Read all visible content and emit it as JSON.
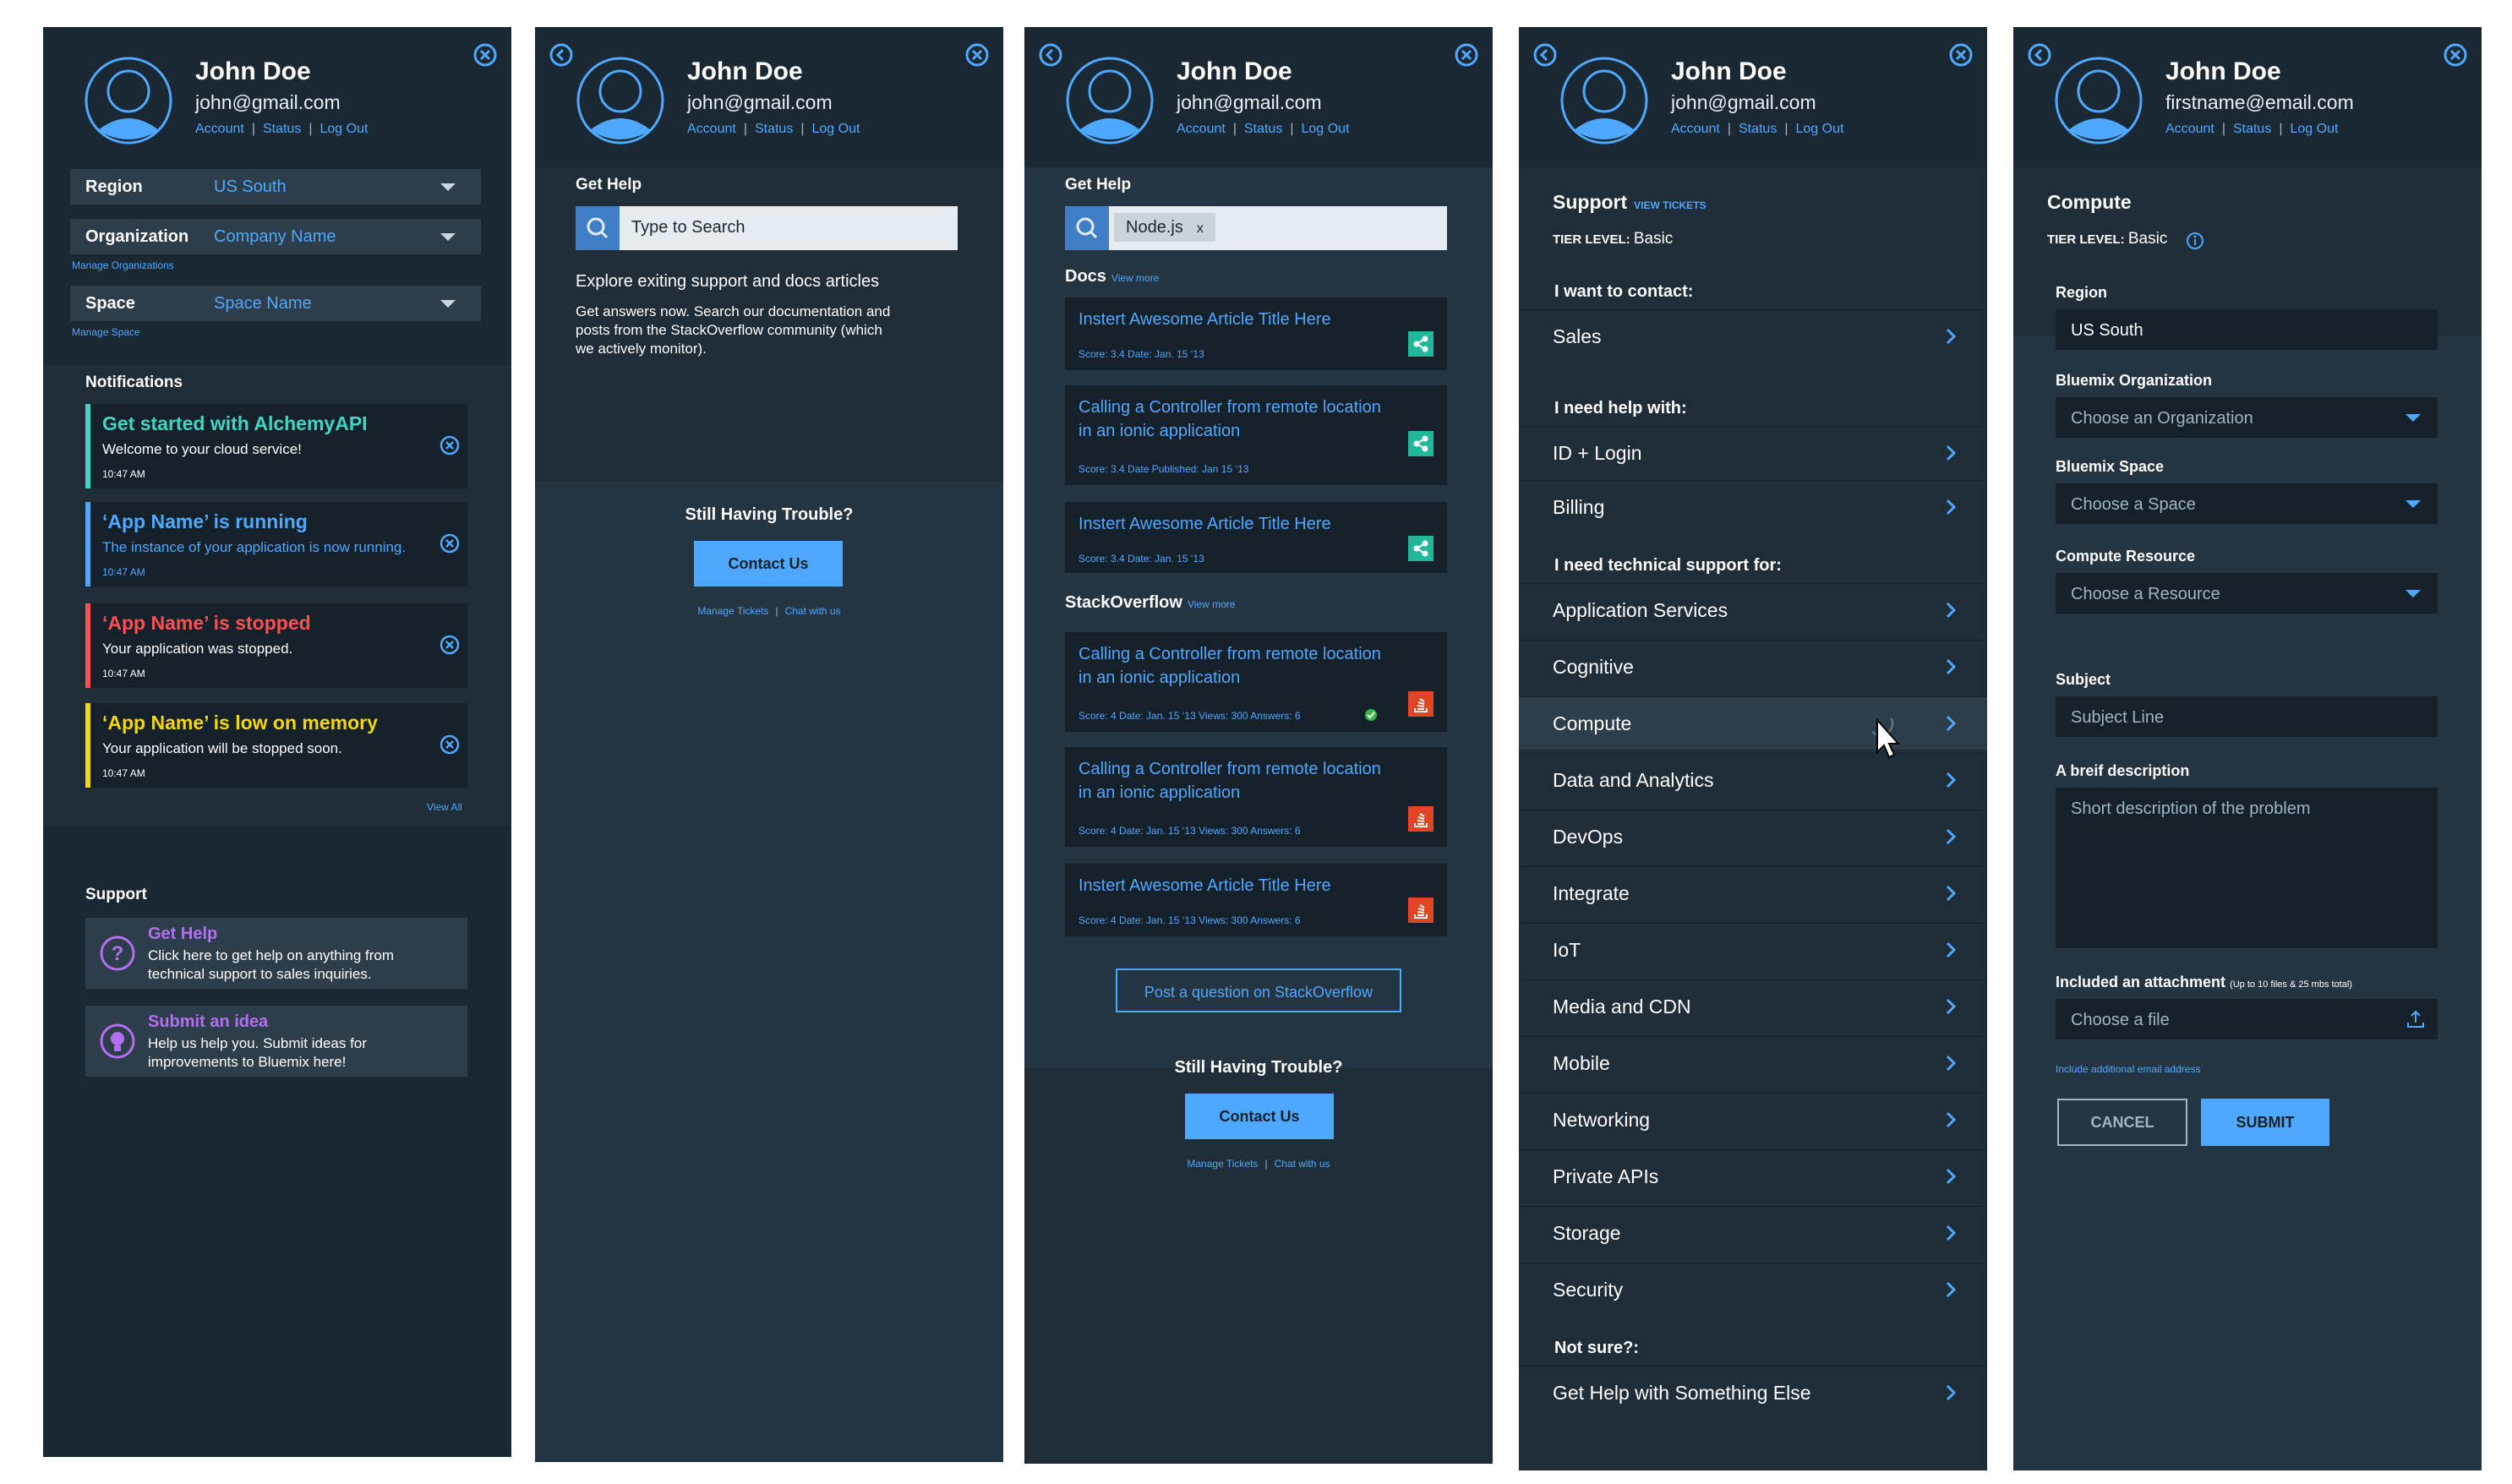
{
  "user": {
    "name": "John Doe",
    "email": "john@gmail.com",
    "email_alt": "firstname@email.com",
    "links": [
      "Account",
      "Status",
      "Log Out"
    ]
  },
  "panel1": {
    "region": {
      "label": "Region",
      "value": "US South"
    },
    "organization": {
      "label": "Organization",
      "value": "Company Name",
      "manage": "Manage Organizations"
    },
    "space": {
      "label": "Space",
      "value": "Space Name",
      "manage": "Manage Space"
    },
    "notifications_title": "Notifications",
    "notifications": [
      {
        "title": "Get started with AlchemyAPI",
        "desc": "Welcome to your cloud service!",
        "time": "10:47 AM",
        "color": "#41d6c3",
        "desc_color": "#ffffff"
      },
      {
        "title": "‘App Name’ is running",
        "desc": "The instance of your application is now running.",
        "time": "10:47 AM",
        "color": "#4fa8ff",
        "desc_color": "#4fa8ff"
      },
      {
        "title": "‘App Name’ is stopped",
        "desc": "Your application was stopped.",
        "time": "10:47 AM",
        "color": "#ff5050",
        "desc_color": "#ffffff"
      },
      {
        "title": "‘App Name’ is low on memory",
        "desc": "Your application will be stopped soon.",
        "time": "10:47 AM",
        "color": "#f5d800",
        "desc_color": "#ffffff"
      }
    ],
    "view_all": "View All",
    "support_title": "Support",
    "support_cards": [
      {
        "title": "Get Help",
        "desc1": "Click here to get help on anything from",
        "desc2": "technical support to sales inquiries.",
        "icon": "question-icon"
      },
      {
        "title": "Submit an idea",
        "desc1": "Help us help you. Submit ideas for",
        "desc2": "improvements to Bluemix here!",
        "icon": "lightbulb-icon"
      }
    ]
  },
  "panel2": {
    "get_help": "Get Help",
    "search_placeholder": "Type to Search",
    "explore_title": "Explore exiting support and docs articles",
    "explore_desc1": "Get answers now. Search our documentation and",
    "explore_desc2": "posts from the StackOverflow community (which",
    "explore_desc3": "we actively monitor).",
    "still_trouble": "Still Having Trouble?",
    "contact": "Contact Us",
    "manage_tickets": "Manage Tickets",
    "chat": "Chat with us"
  },
  "panel3": {
    "get_help": "Get Help",
    "chip": "Node.js",
    "chip_x": "x",
    "docs": "Docs",
    "view_more": "View more",
    "docs_items": [
      {
        "title1": "Instert Awesome Article Title Here",
        "title2": "",
        "meta": "Score: 3.4    Date: Jan. 15 ‘13"
      },
      {
        "title1": "Calling a Controller from remote location",
        "title2": "in an ionic application",
        "meta": "Score: 3.4    Date Published: Jan 15 ‘13"
      },
      {
        "title1": "Instert Awesome Article Title Here",
        "title2": "",
        "meta": "Score: 3.4    Date: Jan. 15 ‘13"
      }
    ],
    "stackoverflow": "StackOverflow",
    "so_items": [
      {
        "title1": "Calling a Controller from remote location",
        "title2": "in an ionic application",
        "meta": "Score: 4    Date: Jan. 15 ‘13    Views: 300    Answers: 6"
      },
      {
        "title1": "Calling a Controller from remote location",
        "title2": "in an ionic application",
        "meta": "Score: 4    Date: Jan. 15 ‘13    Views: 300    Answers: 6"
      },
      {
        "title1": "Instert Awesome Article Title Here",
        "title2": "",
        "meta": "Score: 4    Date: Jan. 15 ‘13    Views: 300    Answers: 6"
      }
    ],
    "post_question": "Post a question on StackOverflow",
    "still_trouble": "Still Having Trouble?",
    "contact": "Contact Us",
    "manage_tickets": "Manage Tickets",
    "chat": "Chat with us"
  },
  "panel4": {
    "support": "Support",
    "view_tickets": "VIEW TICKETS",
    "tier_label": "TIER LEVEL:",
    "tier_value": "Basic",
    "contact_title": "I want to contact:",
    "contact_items": [
      "Sales"
    ],
    "help_title": "I need help with:",
    "help_items": [
      "ID + Login",
      "Billing"
    ],
    "tech_title": "I need technical support for:",
    "tech_items": [
      "Application Services",
      "Cognitive",
      "Compute",
      "Data and Analytics",
      "DevOps",
      "Integrate",
      "IoT",
      "Media and CDN",
      "Mobile",
      "Networking",
      "Private APIs",
      "Storage",
      "Security"
    ],
    "not_sure": "Not sure?:",
    "else_item": "Get Help with Something Else"
  },
  "panel5": {
    "title": "Compute",
    "tier_label": "TIER LEVEL:",
    "tier_value": "Basic",
    "region_label": "Region",
    "region_value": "US South",
    "org_label": "Bluemix Organization",
    "org_value": "Choose an Organization",
    "space_label": "Bluemix Space",
    "space_value": "Choose a Space",
    "resource_label": "Compute Resource",
    "resource_value": "Choose a Resource",
    "subject_label": "Subject",
    "subject_placeholder": "Subject Line",
    "desc_label": "A breif description",
    "desc_placeholder": "Short description of the problem",
    "attach_label": "Included an attachment",
    "attach_note": "(Up to 10 files & 25 mbs total)",
    "attach_placeholder": "Choose a file",
    "include_email": "Include additional email address",
    "cancel": "CANCEL",
    "submit": "SUBMIT"
  },
  "colors": {
    "accent": "#4fa8ff",
    "panel": "#1f2d38",
    "header": "#1a2833",
    "button": "#4fa8ff"
  }
}
